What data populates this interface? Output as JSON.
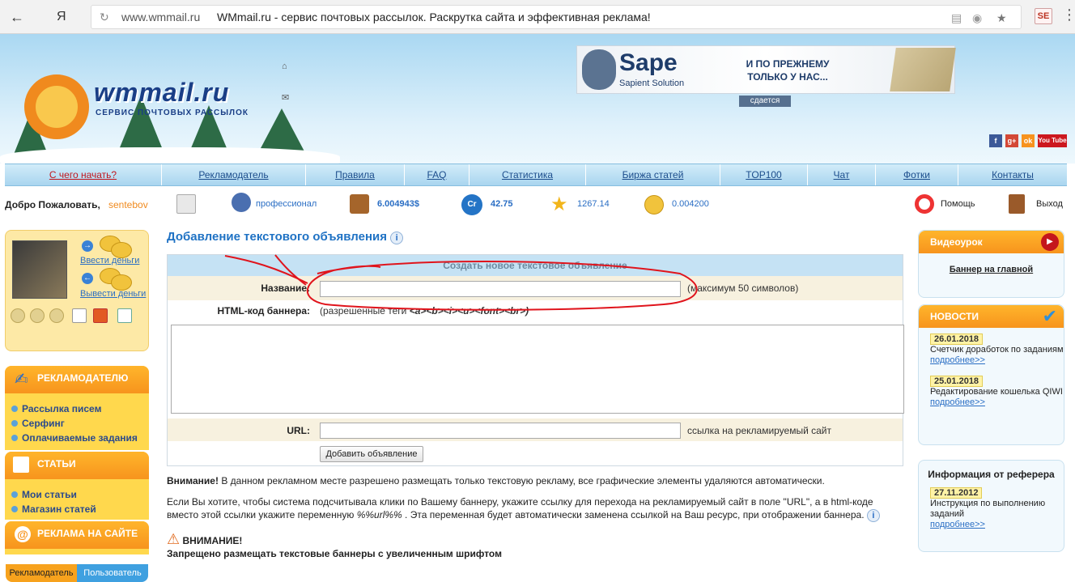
{
  "browser": {
    "yandex": "Я",
    "domain": "www.wmmail.ru",
    "title": "WMmail.ru - сервис почтовых рассылок. Раскрутка сайта и эффективная реклама!",
    "ext": "SE"
  },
  "logo": {
    "name": "wmmail.ru",
    "tagline": "СЕРВИС ПОЧТОВЫХ РАССЫЛОК"
  },
  "banner": {
    "brand": "Sape",
    "sub": "Sapient Solution",
    "msg1": "И ПО ПРЕЖНЕМУ",
    "msg2": "ТОЛЬКО У НАС...",
    "tag": "сдается"
  },
  "social": {
    "yt": "You Tube"
  },
  "nav": [
    "С чего начать?",
    "Рекламодатель",
    "Правила",
    "FAQ",
    "Статистика",
    "Биржа статей",
    "TOP100",
    "Чат",
    "Фотки",
    "Контакты"
  ],
  "status": {
    "welcome": "Добро Пожаловать,",
    "user": "sentebov",
    "level": "профессионал",
    "balance": "6.004943$",
    "cr": "42.75",
    "cr_icon": "Cr",
    "rating": "1267.14",
    "other": "0.004200",
    "help": "Помощь",
    "exit": "Выход"
  },
  "user": {
    "deposit": "Ввести деньги",
    "withdraw": "Вывести деньги",
    "tab_adv": "Рекламодатель",
    "tab_user": "Пользователь"
  },
  "panels": {
    "adv": {
      "title": "РЕКЛАМОДАТЕЛЮ",
      "items": [
        "Рассылка писем",
        "Серфинг",
        "Оплачиваемые задания"
      ]
    },
    "art": {
      "title": "СТАТЬИ",
      "items": [
        "Мои статьи",
        "Магазин статей"
      ]
    },
    "site": {
      "title": "РЕКЛАМА НА САЙТЕ"
    }
  },
  "main": {
    "title": "Добавление текстового объявления",
    "form_head": "Создать новое текстовое объявление",
    "name_label": "Название:",
    "name_note": "(максимум 50 символов)",
    "html_label": "HTML-код баннера:",
    "html_note": "(разрешенные теги",
    "html_tags": "<a><b><i><u><font><br>)",
    "url_label": "URL:",
    "url_note": "ссылка на рекламируемый сайт",
    "submit": "Добавить объявление",
    "warn_b": "Внимание!",
    "warn": " В данном рекламном месте разрешено размещать только текстовую рекламу, все графические элементы удаляются автоматически.",
    "p2a": "Если Вы хотите, чтобы система подсчитывала клики по Вашему баннеру, укажите ссылку для перехода на рекламируемый сайт в поле \"URL\", а в html-коде",
    "p2b": "вместо этой ссылки укажите переменную ",
    "p2var": "%%url%%",
    "p2c": " . Эта переменная будет автоматически заменена ссылкой на Ваш ресурс, при отображении баннера.",
    "attn": "ВНИМАНИЕ!",
    "attn2": "Запрещено размещать текстовые баннеры с увеличенным шрифтом"
  },
  "right": {
    "video": {
      "title": "Видеоурок",
      "link": "Баннер на главной"
    },
    "news": {
      "title": "НОВОСТИ",
      "items": [
        {
          "date": "26.01.2018",
          "text": "Счетчик доработок по заданиям",
          "more": "подробнее>>"
        },
        {
          "date": "25.01.2018",
          "text": "Редактирование кошелька QIWI",
          "more": "подробнее>>"
        }
      ]
    },
    "ref": {
      "title": "Информация от реферера",
      "date": "27.11.2012",
      "text": "Инструкция по выполнению заданий",
      "more": "подробнее>>"
    }
  },
  "colors": {
    "accent": "#1f72c4",
    "orange": "#f7941d",
    "nav": "#a9d5ef",
    "annotation": "#e0141c"
  }
}
